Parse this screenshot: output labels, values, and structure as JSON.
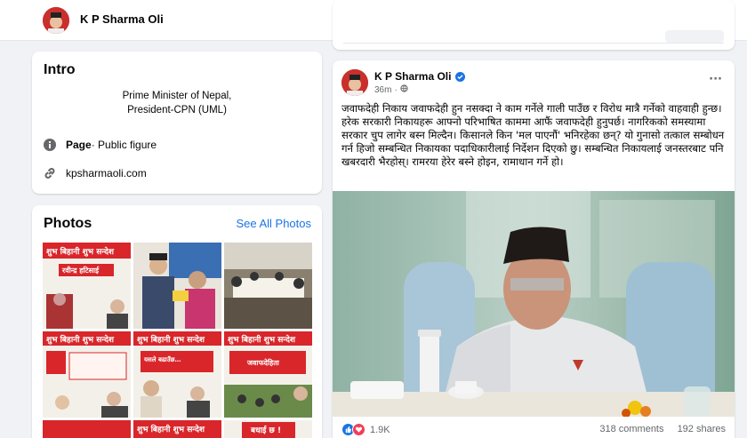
{
  "header": {
    "page_name": "K P Sharma Oli",
    "more_label": "···"
  },
  "intro": {
    "title": "Intro",
    "bio_line1": "Prime Minister of Nepal,",
    "bio_line2": "President-CPN (UML)",
    "category_label": "Page",
    "category_value": " · Public figure",
    "website": "kpsharmaoli.com"
  },
  "photos": {
    "title": "Photos",
    "see_all": "See All Photos",
    "poster_banner": "शुभ बिहानी शुभ सन्देश",
    "poster_texts": [
      "रवीन्द्र हटिसाई",
      "यसले बढाउँछ…",
      "जवाफदेहिता",
      "बधाई छ !"
    ]
  },
  "post": {
    "author": "K P Sharma Oli",
    "time": "36m",
    "more_label": "···",
    "paragraph1": "जवाफदेही निकाय जवाफदेही हुन नसक्दा ने काम गर्नेले गाली पाउँछ र विरोध मात्रै गर्नेको वाहवाही हुन्छ।",
    "paragraph2": "हरेक सरकारी निकायहरू आफ्नो परिभाषित काममा आफैं जवाफदेही हुनुपर्छ। नागरिकको समस्यामा सरकार चुप लागेर बस्न मिल्दैन। किसानले किन 'मल पाएनौं' भनिरहेका छन्? यो गुनासो तत्काल सम्बोधन गर्न हिजो सम्बन्धित निकायका पदाधिकारीलाई निर्देशन दिएको छु। सम्बन्धित निकायलाई जनस्तरबाट पनि खबरदारी भैरहोस्। रामरया हेरेर बस्ने होइन, रामाधान गर्ने हो।",
    "reaction_count": "1.9K",
    "comments": "318 comments",
    "shares": "192 shares"
  },
  "colors": {
    "accent": "#1b74e4",
    "love": "#f33e58",
    "poster_red": "#d8262b"
  }
}
